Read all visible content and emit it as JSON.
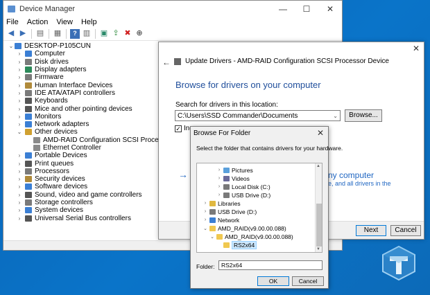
{
  "device_manager": {
    "title": "Device Manager",
    "menu": [
      "File",
      "Action",
      "View",
      "Help"
    ],
    "root": "DESKTOP-P105CUN",
    "categories": [
      {
        "label": "Computer",
        "color": "#3b7fd4"
      },
      {
        "label": "Disk drives",
        "color": "#7a7a7a"
      },
      {
        "label": "Display adapters",
        "color": "#2c8a5a"
      },
      {
        "label": "Firmware",
        "color": "#7a7a7a"
      },
      {
        "label": "Human Interface Devices",
        "color": "#b08a3a"
      },
      {
        "label": "IDE ATA/ATAPI controllers",
        "color": "#7a7a7a"
      },
      {
        "label": "Keyboards",
        "color": "#555555"
      },
      {
        "label": "Mice and other pointing devices",
        "color": "#555555"
      },
      {
        "label": "Monitors",
        "color": "#3b7fd4"
      },
      {
        "label": "Network adapters",
        "color": "#3b7fd4"
      },
      {
        "label": "Other devices",
        "color": "#d0a030",
        "expanded": true
      },
      {
        "label": "AMD-RAID Configuration SCSI Processor Device",
        "color": "#8a8a8a",
        "child": true
      },
      {
        "label": "Ethernet Controller",
        "color": "#8a8a8a",
        "child": true
      },
      {
        "label": "Portable Devices",
        "color": "#3b7fd4"
      },
      {
        "label": "Print queues",
        "color": "#555555"
      },
      {
        "label": "Processors",
        "color": "#7a7a7a"
      },
      {
        "label": "Security devices",
        "color": "#b08a3a"
      },
      {
        "label": "Software devices",
        "color": "#3b7fd4"
      },
      {
        "label": "Sound, video and game controllers",
        "color": "#555555"
      },
      {
        "label": "Storage controllers",
        "color": "#7a7a7a"
      },
      {
        "label": "System devices",
        "color": "#3b7fd4"
      },
      {
        "label": "Universal Serial Bus controllers",
        "color": "#555555"
      }
    ]
  },
  "update_drivers": {
    "title": "Update Drivers - AMD-RAID Configuration SCSI Processor Device",
    "heading": "Browse for drivers on your computer",
    "search_label": "Search for drivers in this location:",
    "path_value": "C:\\Users\\SSD Commander\\Documents",
    "browse_label": "Browse...",
    "include_label": "Inc",
    "pick_title": "ny computer",
    "pick_desc": "e, and all drivers in the",
    "next_label": "Next",
    "cancel_label": "Cancel"
  },
  "browse_folder": {
    "title": "Browse For Folder",
    "instruction": "Select the folder that contains drivers for your hardware.",
    "tree": [
      {
        "label": "Pictures",
        "indent": 2,
        "arrow": "›",
        "color": "#5aa0dc"
      },
      {
        "label": "Videos",
        "indent": 2,
        "arrow": "›",
        "color": "#6a6a9a"
      },
      {
        "label": "Local Disk (C:)",
        "indent": 2,
        "arrow": "›",
        "color": "#7a7a7a"
      },
      {
        "label": "USB Drive (D:)",
        "indent": 2,
        "arrow": "›",
        "color": "#7a7a7a"
      },
      {
        "label": "Libraries",
        "indent": 0,
        "arrow": "›",
        "color": "#e0b840"
      },
      {
        "label": "USB Drive (D:)",
        "indent": 0,
        "arrow": "›",
        "color": "#7a7a7a"
      },
      {
        "label": "Network",
        "indent": 0,
        "arrow": "›",
        "color": "#3b7fd4"
      },
      {
        "label": "AMD_RAID(v9.00.00.088)",
        "indent": 0,
        "arrow": "⌄",
        "color": "#f0c850"
      },
      {
        "label": "AMD_RAID(v9.00.00.088)",
        "indent": 1,
        "arrow": "⌄",
        "color": "#f0c850"
      },
      {
        "label": "RS2x64",
        "indent": 2,
        "arrow": "",
        "color": "#f0c850",
        "selected": true
      }
    ],
    "folder_label": "Folder:",
    "folder_value": "RS2x64",
    "ok_label": "OK",
    "cancel_label": "Cancel"
  }
}
